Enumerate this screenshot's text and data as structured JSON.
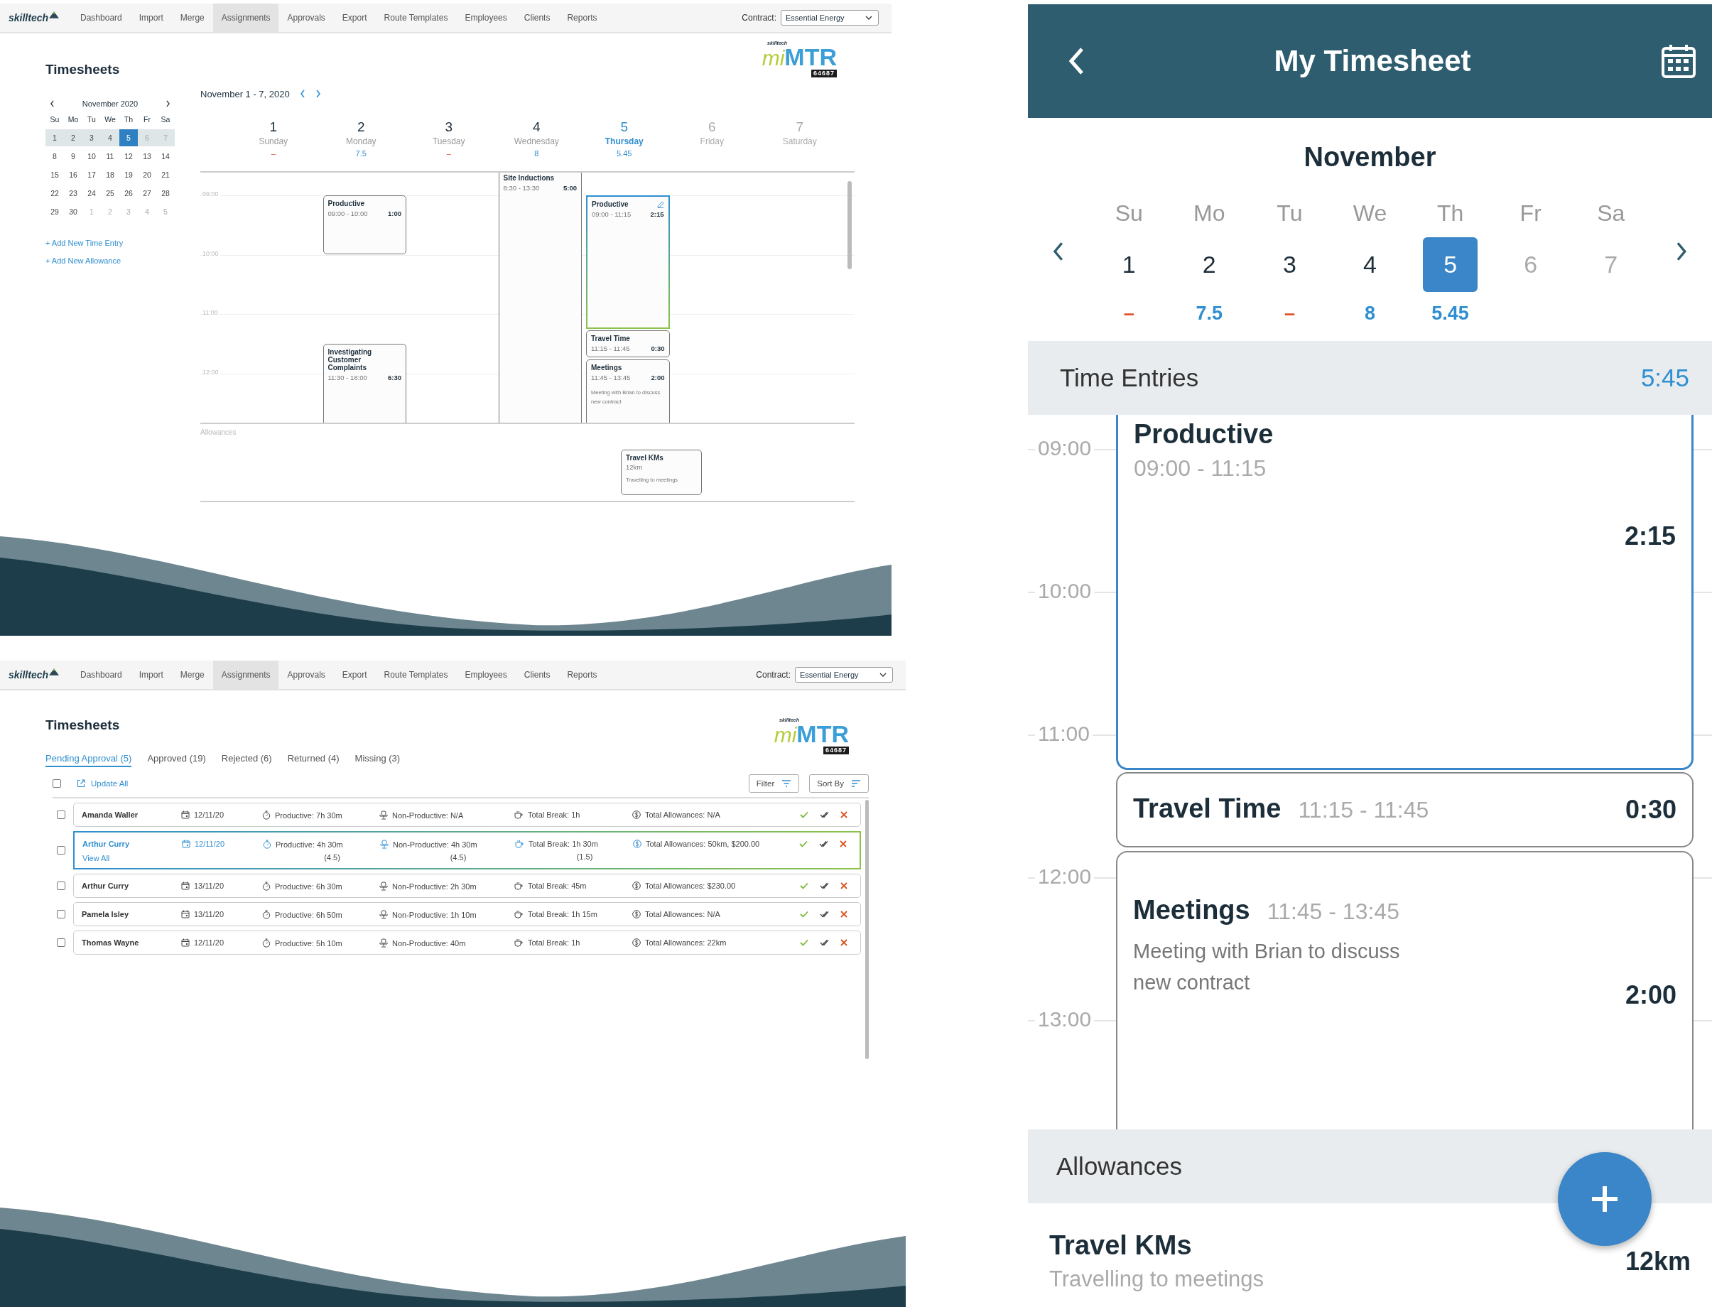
{
  "week_view": {
    "nav": {
      "logo": "skilltech",
      "items": [
        {
          "label": "Dashboard",
          "selected": false
        },
        {
          "label": "Import",
          "selected": false
        },
        {
          "label": "Merge",
          "selected": false
        },
        {
          "label": "Assignments",
          "selected": true
        },
        {
          "label": "Approvals",
          "selected": false
        },
        {
          "label": "Export",
          "selected": false
        },
        {
          "label": "Route Templates",
          "selected": false
        },
        {
          "label": "Employees",
          "selected": false
        },
        {
          "label": "Clients",
          "selected": false
        },
        {
          "label": "Reports",
          "selected": false
        }
      ],
      "contract_label": "Contract:",
      "contract_value": "Essential Energy"
    },
    "title": "Timesheets",
    "brand": {
      "small": "skilltech",
      "mi": "mi",
      "mtr": "MTR",
      "code": "64687"
    },
    "mini_calendar": {
      "month": "November 2020",
      "weekdays": [
        "Su",
        "Mo",
        "Tu",
        "We",
        "Th",
        "Fr",
        "Sa"
      ],
      "weeks": [
        {
          "highlighted": true,
          "days": [
            {
              "day": "1",
              "selected": false,
              "muted": false
            },
            {
              "day": "2",
              "selected": false,
              "muted": false
            },
            {
              "day": "3",
              "selected": false,
              "muted": false
            },
            {
              "day": "4",
              "selected": false,
              "muted": false
            },
            {
              "day": "5",
              "selected": true,
              "muted": false
            },
            {
              "day": "6",
              "selected": false,
              "muted": true
            },
            {
              "day": "7",
              "selected": false,
              "muted": true
            }
          ]
        },
        {
          "highlighted": false,
          "days": [
            {
              "day": "8",
              "selected": false,
              "muted": false
            },
            {
              "day": "9",
              "selected": false,
              "muted": false
            },
            {
              "day": "10",
              "selected": false,
              "muted": false
            },
            {
              "day": "11",
              "selected": false,
              "muted": false
            },
            {
              "day": "12",
              "selected": false,
              "muted": false
            },
            {
              "day": "13",
              "selected": false,
              "muted": false
            },
            {
              "day": "14",
              "selected": false,
              "muted": false
            }
          ]
        },
        {
          "highlighted": false,
          "days": [
            {
              "day": "15",
              "selected": false,
              "muted": false
            },
            {
              "day": "16",
              "selected": false,
              "muted": false
            },
            {
              "day": "17",
              "selected": false,
              "muted": false
            },
            {
              "day": "18",
              "selected": false,
              "muted": false
            },
            {
              "day": "19",
              "selected": false,
              "muted": false
            },
            {
              "day": "20",
              "selected": false,
              "muted": false
            },
            {
              "day": "21",
              "selected": false,
              "muted": false
            }
          ]
        },
        {
          "highlighted": false,
          "days": [
            {
              "day": "22",
              "selected": false,
              "muted": false
            },
            {
              "day": "23",
              "selected": false,
              "muted": false
            },
            {
              "day": "24",
              "selected": false,
              "muted": false
            },
            {
              "day": "25",
              "selected": false,
              "muted": false
            },
            {
              "day": "26",
              "selected": false,
              "muted": false
            },
            {
              "day": "27",
              "selected": false,
              "muted": false
            },
            {
              "day": "28",
              "selected": false,
              "muted": false
            }
          ]
        },
        {
          "highlighted": false,
          "days": [
            {
              "day": "29",
              "selected": false,
              "muted": false
            },
            {
              "day": "30",
              "selected": false,
              "muted": false
            },
            {
              "day": "1",
              "selected": false,
              "muted": true
            },
            {
              "day": "2",
              "selected": false,
              "muted": true
            },
            {
              "day": "3",
              "selected": false,
              "muted": true
            },
            {
              "day": "4",
              "selected": false,
              "muted": true
            },
            {
              "day": "5",
              "selected": false,
              "muted": true
            }
          ]
        }
      ]
    },
    "links": [
      "+ Add New Time Entry",
      "+ Add New Allowance"
    ],
    "range": "November 1 - 7, 2020",
    "hours": [
      "09:00",
      "10:00",
      "11:00",
      "12:00"
    ],
    "days": [
      {
        "number": "1",
        "name": "Sunday",
        "total": "–",
        "kind": "missing",
        "selected": false
      },
      {
        "number": "2",
        "name": "Monday",
        "total": "7.5",
        "kind": "logged",
        "selected": false,
        "entries": [
          {
            "title": "Productive",
            "time": "09:00 - 10:00",
            "duration": "1:00",
            "selected": false
          },
          {
            "title": "Investigating Customer Complaints",
            "time": "11:30 - 18:00",
            "duration": "6:30",
            "selected": false
          }
        ]
      },
      {
        "number": "3",
        "name": "Tuesday",
        "total": "–",
        "kind": "missing",
        "selected": false
      },
      {
        "number": "4",
        "name": "Wednesday",
        "total": "8",
        "kind": "logged",
        "selected": false,
        "entries": [
          {
            "title": "Site Inductions",
            "time": "8:30 - 13:30",
            "duration": "5:00",
            "selected": false
          }
        ]
      },
      {
        "number": "5",
        "name": "Thursday",
        "total": "5.45",
        "kind": "logged",
        "selected": true,
        "entries": [
          {
            "title": "Productive",
            "time": "09:00 - 11:15",
            "duration": "2:15",
            "selected": true
          },
          {
            "title": "Travel Time",
            "time": "11:15 - 11:45",
            "duration": "0:30",
            "selected": false
          },
          {
            "title": "Meetings",
            "time": "11:45 - 13:45",
            "duration": "2:00",
            "note": "Meeting with Brian to discuss new contract",
            "selected": false
          }
        ]
      },
      {
        "number": "6",
        "name": "Friday",
        "kind": "future",
        "selected": false
      },
      {
        "number": "7",
        "name": "Saturday",
        "kind": "future",
        "selected": false
      }
    ],
    "allowances": {
      "label": "Allowances",
      "entries": [
        {
          "title": "Travel KMs",
          "amount": "12km",
          "note": "Travelling to meetings"
        }
      ]
    }
  },
  "approval_view": {
    "nav": {
      "logo": "skilltech",
      "items": [
        {
          "label": "Dashboard",
          "selected": false
        },
        {
          "label": "Import",
          "selected": false
        },
        {
          "label": "Merge",
          "selected": false
        },
        {
          "label": "Assignments",
          "selected": true
        },
        {
          "label": "Approvals",
          "selected": false
        },
        {
          "label": "Export",
          "selected": false
        },
        {
          "label": "Route Templates",
          "selected": false
        },
        {
          "label": "Employees",
          "selected": false
        },
        {
          "label": "Clients",
          "selected": false
        },
        {
          "label": "Reports",
          "selected": false
        }
      ],
      "contract_label": "Contract:",
      "contract_value": "Essential Energy"
    },
    "title": "Timesheets",
    "brand": {
      "small": "skilltech",
      "mi": "mi",
      "mtr": "MTR",
      "code": "64687"
    },
    "tabs": [
      {
        "label": "Pending Approval (5)",
        "selected": true
      },
      {
        "label": "Approved (19)",
        "selected": false
      },
      {
        "label": "Rejected (6)",
        "selected": false
      },
      {
        "label": "Returned (4)",
        "selected": false
      },
      {
        "label": "Missing (3)",
        "selected": false
      }
    ],
    "select_all": {
      "checked": false
    },
    "update_all": "Update All",
    "filter": "Filter",
    "sort_by": "Sort By",
    "rows": [
      {
        "name": "Amanda Waller",
        "date": "12/11/20",
        "productive": "Productive: 7h 30m",
        "non_productive": "Non-Productive: N/A",
        "total_break": "Total Break: 1h",
        "allowances": "Total Allowances: N/A",
        "checked": false,
        "selected": false
      },
      {
        "name": "Arthur Curry",
        "date": "12/11/20",
        "productive": "Productive: 4h 30m",
        "productive_hours": "(4.5)",
        "non_productive": "Non-Productive: 4h 30m",
        "non_productive_hours": "(4.5)",
        "total_break": "Total Break: 1h 30m",
        "break_hours": "(1.5)",
        "allowances": "Total Allowances: 50km, $200.00",
        "view_all": "View All",
        "checked": false,
        "selected": true
      },
      {
        "name": "Arthur Curry",
        "date": "13/11/20",
        "productive": "Productive: 6h 30m",
        "non_productive": "Non-Productive: 2h 30m",
        "total_break": "Total Break: 45m",
        "allowances": "Total Allowances: $230.00",
        "checked": false,
        "selected": false
      },
      {
        "name": "Pamela Isley",
        "date": "13/11/20",
        "productive": "Productive: 6h 50m",
        "non_productive": "Non-Productive: 1h 10m",
        "total_break": "Total Break: 1h 15m",
        "allowances": "Total Allowances: N/A",
        "checked": false,
        "selected": false
      },
      {
        "name": "Thomas Wayne",
        "date": "12/11/20",
        "productive": "Productive: 5h 10m",
        "non_productive": "Non-Productive: 40m",
        "total_break": "Total Break: 1h",
        "allowances": "Total Allowances: 22km",
        "checked": false,
        "selected": false
      }
    ]
  },
  "mobile": {
    "title": "My Timesheet",
    "month": "November",
    "days": [
      {
        "short": "Su",
        "number": "1",
        "total": "–",
        "kind": "missing",
        "selected": false
      },
      {
        "short": "Mo",
        "number": "2",
        "total": "7.5",
        "kind": "logged",
        "selected": false
      },
      {
        "short": "Tu",
        "number": "3",
        "total": "–",
        "kind": "missing",
        "selected": false
      },
      {
        "short": "We",
        "number": "4",
        "total": "8",
        "kind": "logged",
        "selected": false
      },
      {
        "short": "Th",
        "number": "5",
        "total": "5.45",
        "kind": "logged",
        "selected": true
      },
      {
        "short": "Fr",
        "number": "6",
        "kind": "future",
        "selected": false
      },
      {
        "short": "Sa",
        "number": "7",
        "kind": "future",
        "selected": false
      }
    ],
    "entries_label": "Time Entries",
    "entries_total": "5:45",
    "hours": [
      "09:00",
      "10:00",
      "11:00",
      "12:00",
      "13:00"
    ],
    "entries": [
      {
        "title": "Productive",
        "time": "09:00 - 11:15",
        "duration": "2:15",
        "selected": true
      },
      {
        "title": "Travel Time",
        "time": "11:15 - 11:45",
        "duration": "0:30",
        "selected": false
      },
      {
        "title": "Meetings",
        "time": "11:45 - 13:45",
        "duration": "2:00",
        "note": "Meeting with Brian to discuss new contract",
        "selected": false
      }
    ],
    "allowances_label": "Allowances",
    "allowances": [
      {
        "title": "Travel KMs",
        "note": "Travelling to meetings",
        "amount": "12km"
      }
    ]
  }
}
